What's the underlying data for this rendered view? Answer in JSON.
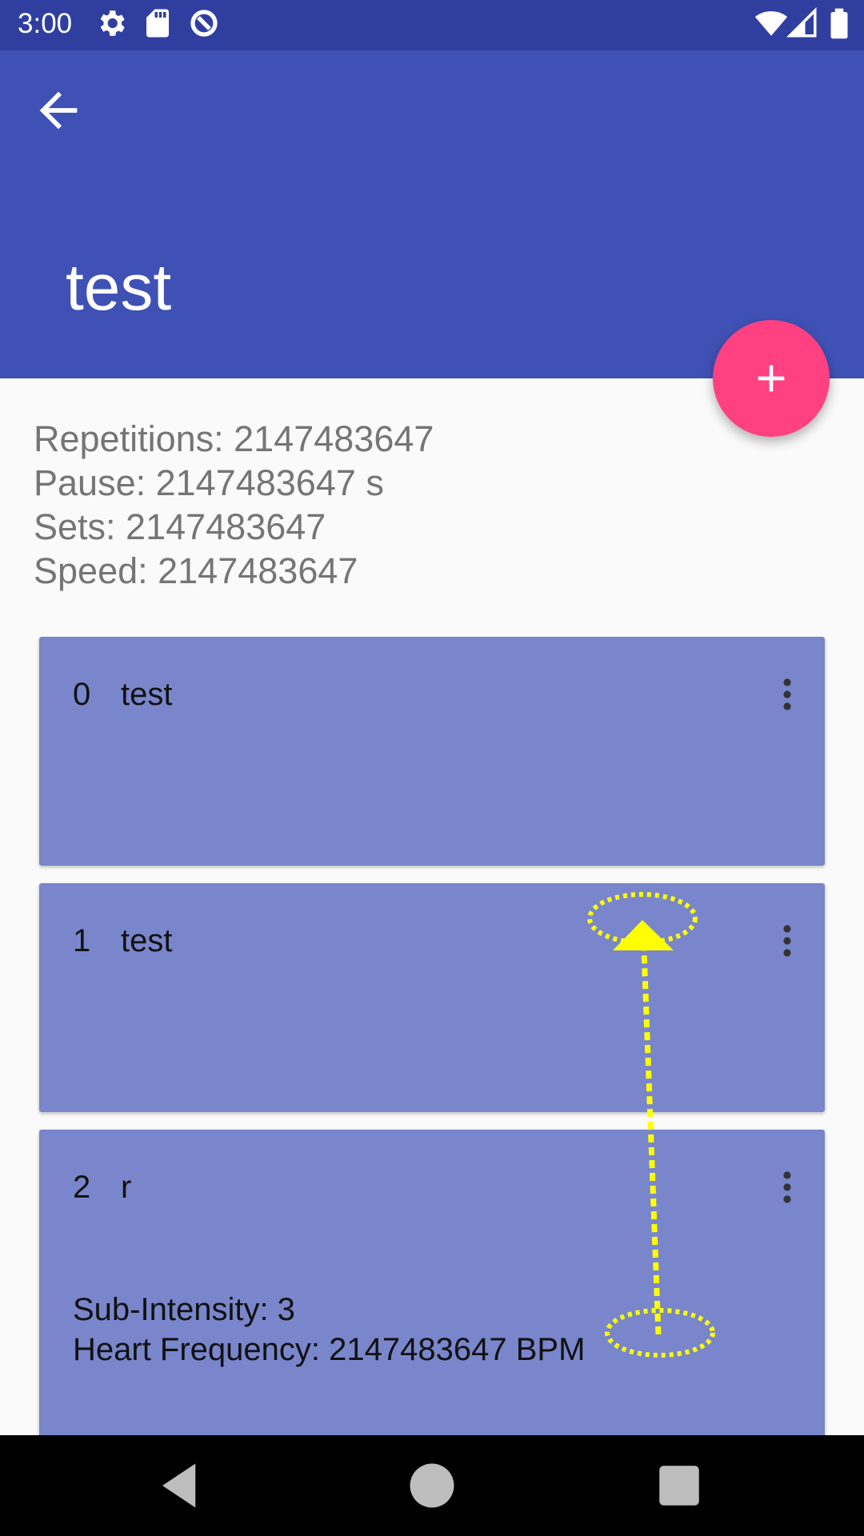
{
  "status_bar": {
    "time": "3:00",
    "icons": [
      "gear-icon",
      "sd-card-icon",
      "data-saver-icon",
      "wifi-icon",
      "signal-icon",
      "battery-icon"
    ]
  },
  "app_bar": {
    "back_icon": "arrow-back-icon",
    "title": "test",
    "color": "#3f51b5"
  },
  "fab": {
    "icon": "plus-icon",
    "color": "#ff4081"
  },
  "summary": {
    "repetitions": "Repetitions: 2147483647",
    "pause": "Pause: 2147483647 s",
    "sets": "Sets: 2147483647",
    "speed": "Speed: 2147483647"
  },
  "cards": [
    {
      "index": "0",
      "name": "test"
    },
    {
      "index": "1",
      "name": "test"
    },
    {
      "index": "2",
      "name": "r",
      "sub_intensity": "Sub-Intensity: 3",
      "heart_frequency": "Heart Frequency: 2147483647 BPM"
    }
  ],
  "card_color": "#7986cb",
  "annotation": {
    "type": "drag-gesture",
    "color": "#ffff00"
  },
  "nav_bar": {
    "buttons": [
      "back-triangle-icon",
      "home-circle-icon",
      "recents-square-icon"
    ]
  }
}
